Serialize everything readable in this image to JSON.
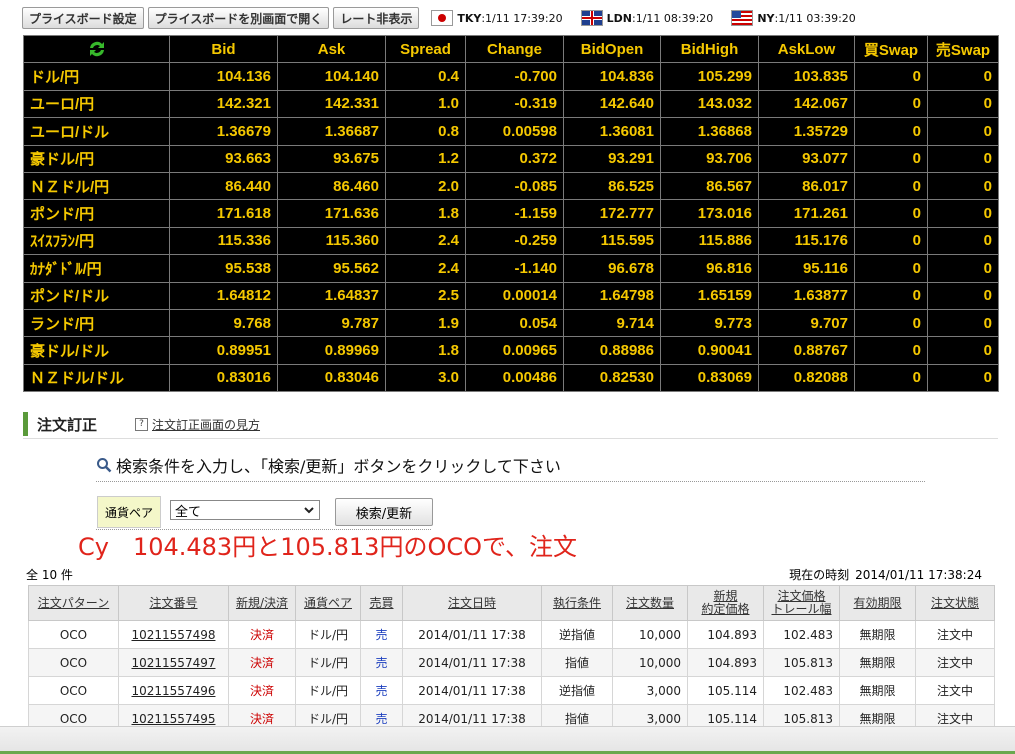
{
  "toolbar": {
    "btn1": "プライスボード設定",
    "btn2": "プライスボードを別画面で開く",
    "btn3": "レート非表示"
  },
  "clocks": [
    {
      "label": "TKY",
      "time": ":1/11  17:39:20"
    },
    {
      "label": "LDN",
      "time": ":1/11  08:39:20"
    },
    {
      "label": "NY",
      "time": ":1/11  03:39:20"
    }
  ],
  "rates": {
    "headers": [
      "Bid",
      "Ask",
      "Spread",
      "Change",
      "BidOpen",
      "BidHigh",
      "AskLow",
      "買Swap",
      "売Swap"
    ],
    "rows": [
      [
        "ドル/円",
        "104.136",
        "104.140",
        "0.4",
        "-0.700",
        "104.836",
        "105.299",
        "103.835",
        "0",
        "0"
      ],
      [
        "ユーロ/円",
        "142.321",
        "142.331",
        "1.0",
        "-0.319",
        "142.640",
        "143.032",
        "142.067",
        "0",
        "0"
      ],
      [
        "ユーロ/ドル",
        "1.36679",
        "1.36687",
        "0.8",
        "0.00598",
        "1.36081",
        "1.36868",
        "1.35729",
        "0",
        "0"
      ],
      [
        "豪ドル/円",
        "93.663",
        "93.675",
        "1.2",
        "0.372",
        "93.291",
        "93.706",
        "93.077",
        "0",
        "0"
      ],
      [
        "ＮＺドル/円",
        "86.440",
        "86.460",
        "2.0",
        "-0.085",
        "86.525",
        "86.567",
        "86.017",
        "0",
        "0"
      ],
      [
        "ポンド/円",
        "171.618",
        "171.636",
        "1.8",
        "-1.159",
        "172.777",
        "173.016",
        "171.261",
        "0",
        "0"
      ],
      [
        "ｽｲｽﾌﾗﾝ/円",
        "115.336",
        "115.360",
        "2.4",
        "-0.259",
        "115.595",
        "115.886",
        "115.176",
        "0",
        "0"
      ],
      [
        "ｶﾅﾀﾞﾄﾞﾙ/円",
        "95.538",
        "95.562",
        "2.4",
        "-1.140",
        "96.678",
        "96.816",
        "95.116",
        "0",
        "0"
      ],
      [
        "ポンド/ドル",
        "1.64812",
        "1.64837",
        "2.5",
        "0.00014",
        "1.64798",
        "1.65159",
        "1.63877",
        "0",
        "0"
      ],
      [
        "ランド/円",
        "9.768",
        "9.787",
        "1.9",
        "0.054",
        "9.714",
        "9.773",
        "9.707",
        "0",
        "0"
      ],
      [
        "豪ドル/ドル",
        "0.89951",
        "0.89969",
        "1.8",
        "0.00965",
        "0.88986",
        "0.90041",
        "0.88767",
        "0",
        "0"
      ],
      [
        "ＮＺドル/ドル",
        "0.83016",
        "0.83046",
        "3.0",
        "0.00486",
        "0.82530",
        "0.83069",
        "0.82088",
        "0",
        "0"
      ]
    ]
  },
  "section": {
    "title": "注文訂正",
    "help_link": "注文訂正画面の見方"
  },
  "search": {
    "instruction": "検索条件を入力し、「検索/更新」ボタンをクリックして下さい",
    "pair_label": "通貨ペア",
    "pair_value": "全て",
    "button": "検索/更新"
  },
  "annotation": "Cy　104.483円と105.813円のOCOで、注文",
  "orders": {
    "count": "全 10 件",
    "now_label": "現在の時刻",
    "now_value": "2014/01/11 17:38:24",
    "headers": [
      "注文パターン",
      "注文番号",
      "新規/決済",
      "通貨ペア",
      "売買",
      "注文日時",
      "執行条件",
      "注文数量",
      "新規\n約定価格",
      "注文価格\nトレール幅",
      "有効期限",
      "注文状態"
    ],
    "rows": [
      [
        "OCO",
        "10211557498",
        "決済",
        "ドル/円",
        "売",
        "2014/01/11 17:38",
        "逆指値",
        "10,000",
        "104.893",
        "102.483",
        "無期限",
        "注文中"
      ],
      [
        "OCO",
        "10211557497",
        "決済",
        "ドル/円",
        "売",
        "2014/01/11 17:38",
        "指値",
        "10,000",
        "104.893",
        "105.813",
        "無期限",
        "注文中"
      ],
      [
        "OCO",
        "10211557496",
        "決済",
        "ドル/円",
        "売",
        "2014/01/11 17:38",
        "逆指値",
        "3,000",
        "105.114",
        "102.483",
        "無期限",
        "注文中"
      ],
      [
        "OCO",
        "10211557495",
        "決済",
        "ドル/円",
        "売",
        "2014/01/11 17:38",
        "指値",
        "3,000",
        "105.114",
        "105.813",
        "無期限",
        "注文中"
      ]
    ]
  }
}
